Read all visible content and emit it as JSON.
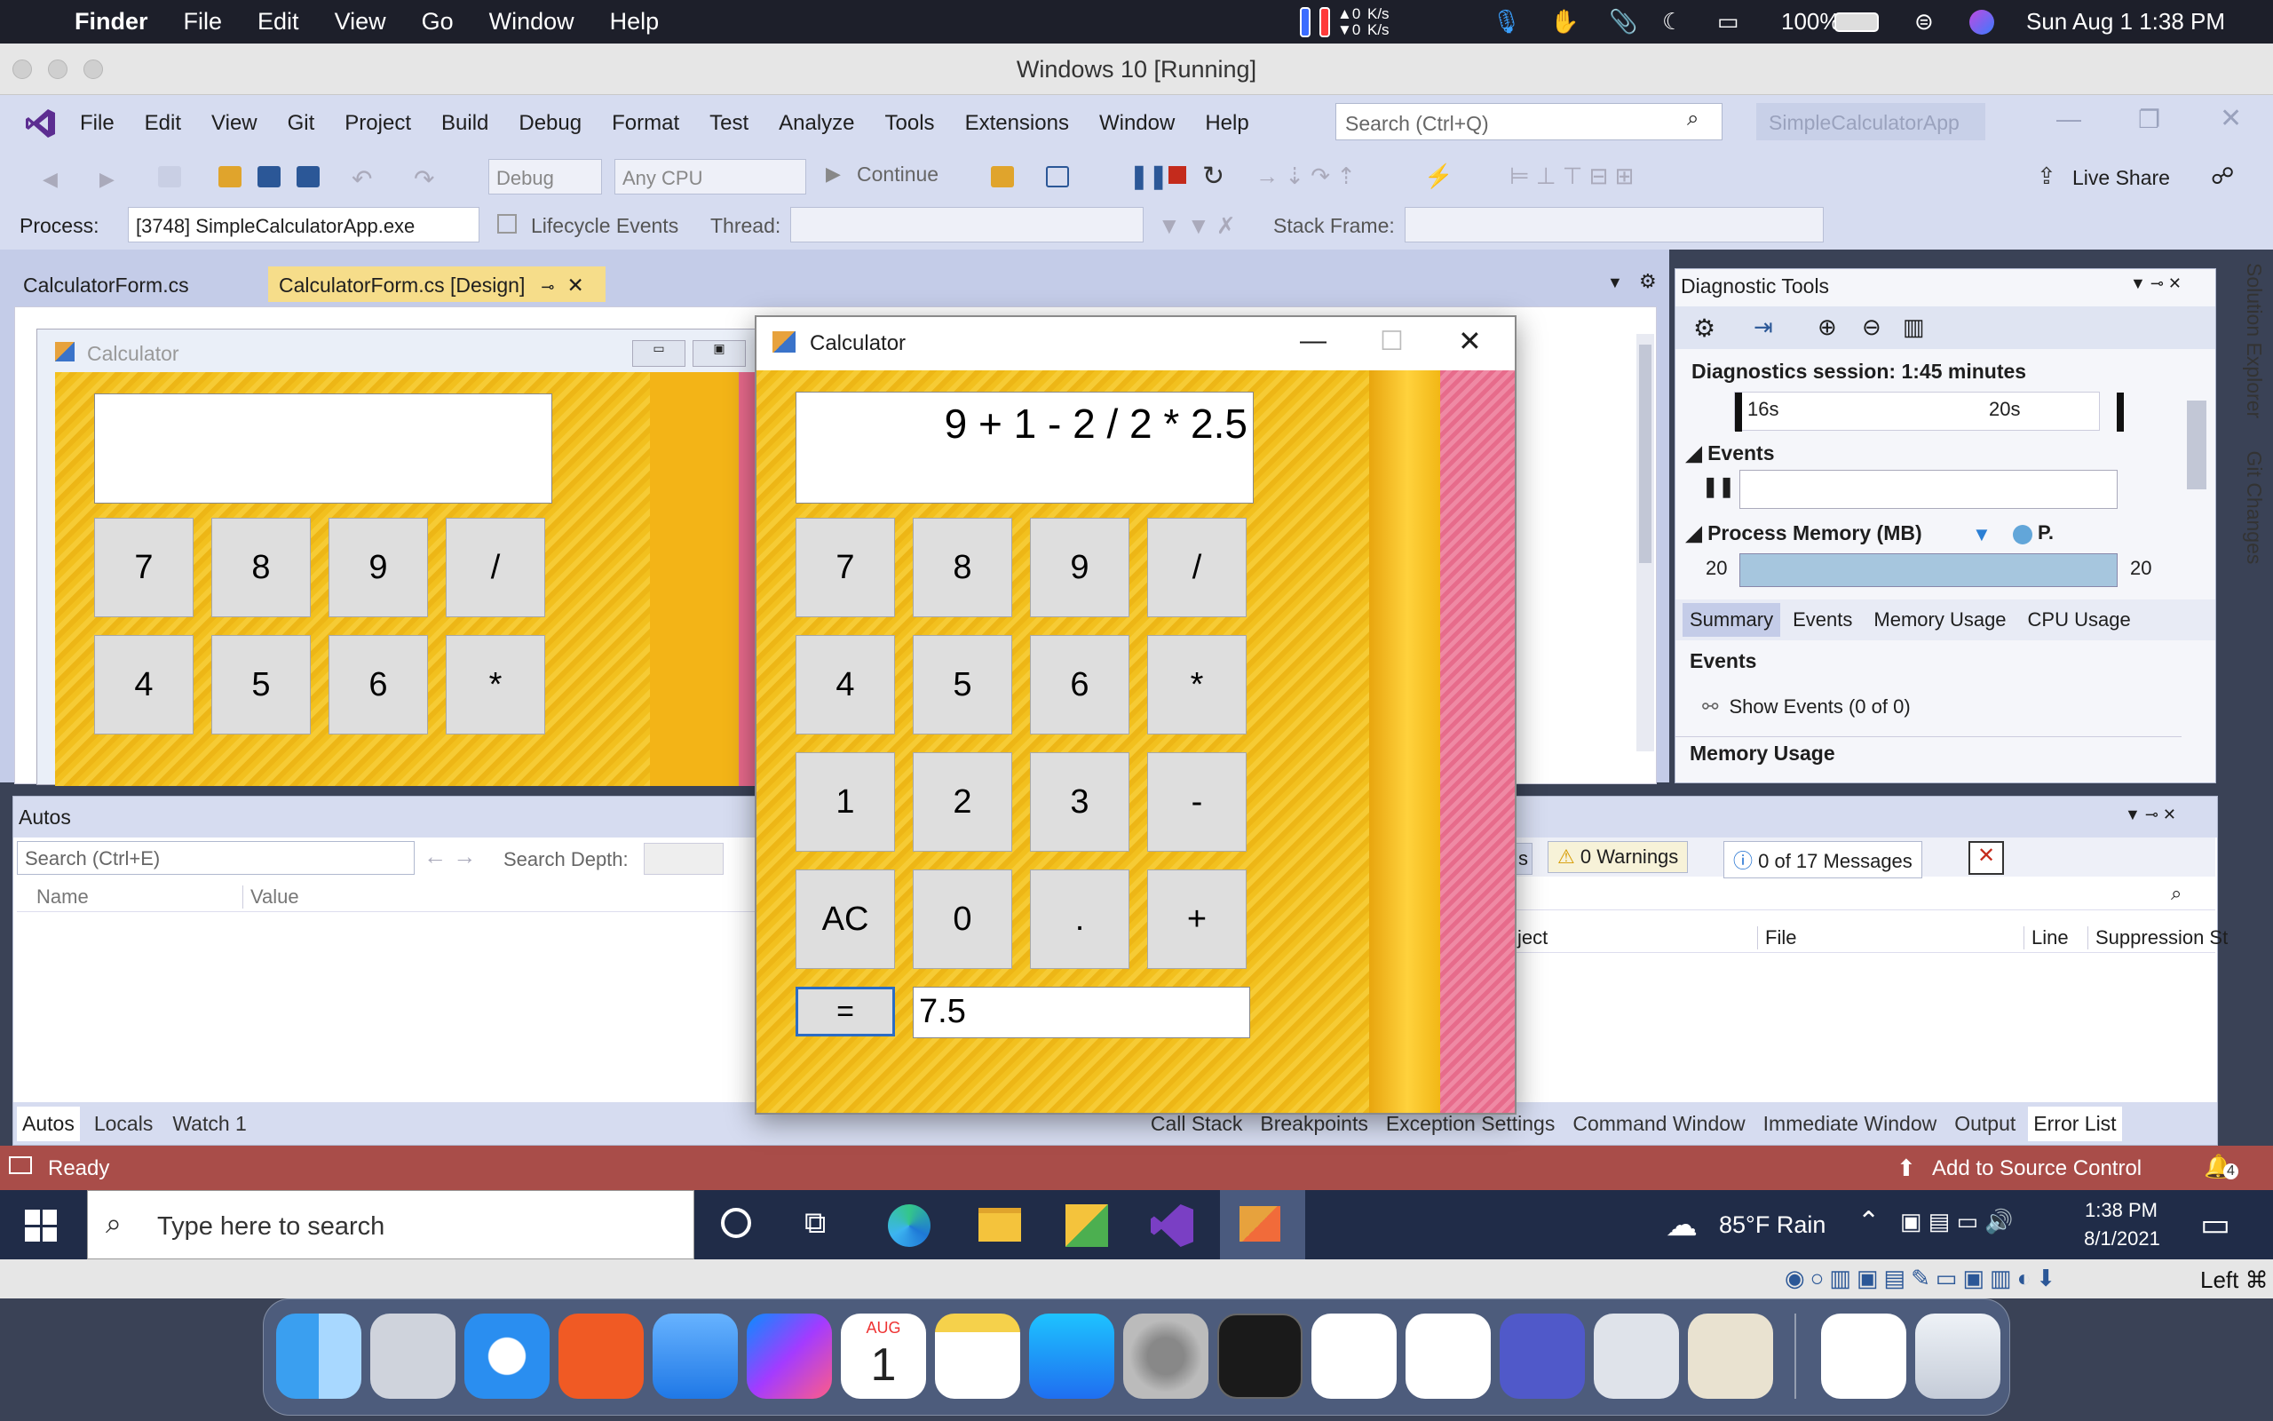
{
  "mac_menubar": {
    "app": "Finder",
    "items": [
      "File",
      "Edit",
      "View",
      "Go",
      "Window",
      "Help"
    ],
    "kbps": [
      "0\nK/s",
      "0\nK/s"
    ],
    "battery": "100%",
    "datetime": "Sun Aug 1  1:38 PM"
  },
  "vbox": {
    "title": "Windows 10 [Running]",
    "status_right": "Left ⌘"
  },
  "vs": {
    "menu": [
      "File",
      "Edit",
      "View",
      "Git",
      "Project",
      "Build",
      "Debug",
      "Format",
      "Test",
      "Analyze",
      "Tools",
      "Extensions",
      "Window",
      "Help"
    ],
    "search_placeholder": "Search (Ctrl+Q)",
    "solution": "SimpleCalculatorApp",
    "config": "Debug",
    "platform": "Any CPU",
    "continue": "Continue",
    "live_share": "Live Share",
    "process_label": "Process:",
    "process_value": "[3748] SimpleCalculatorApp.exe",
    "lifecycle": "Lifecycle Events",
    "thread_label": "Thread:",
    "stackframe_label": "Stack Frame:",
    "tabs": [
      "CalculatorForm.cs",
      "CalculatorForm.cs [Design]"
    ],
    "side_tabs": [
      "Solution Explorer",
      "Git Changes"
    ],
    "status": "Ready",
    "source_control": "Add to Source Control",
    "notif_count": "4"
  },
  "designer_form": {
    "title": "Calculator",
    "rows": [
      [
        "7",
        "8",
        "9",
        "/"
      ],
      [
        "4",
        "5",
        "6",
        "*"
      ]
    ]
  },
  "diag": {
    "title": "Diagnostic Tools",
    "session": "Diagnostics session: 1:45 minutes",
    "ticks": [
      "16s",
      "20s"
    ],
    "events_label": "Events",
    "memory_label": "Process Memory (MB)",
    "legend_p": "P.",
    "mem_left": "20",
    "mem_right": "20",
    "tabs": [
      "Summary",
      "Events",
      "Memory Usage",
      "CPU Usage"
    ],
    "section_events": "Events",
    "show_events": "Show Events (0 of 0)",
    "section_memory": "Memory Usage"
  },
  "autos": {
    "title": "Autos",
    "search_placeholder": "Search (Ctrl+E)",
    "search_depth": "Search Depth:",
    "columns": [
      "Name",
      "Value"
    ],
    "bottom_tabs": [
      "Autos",
      "Locals",
      "Watch 1"
    ],
    "right_tabs": [
      "Call Stack",
      "Breakpoints",
      "Exception Settings",
      "Command Window",
      "Immediate Window",
      "Output",
      "Error List"
    ],
    "errs_partial": "s",
    "warnings": "0 Warnings",
    "messages": "0 of 17 Messages",
    "err_columns": [
      "ject",
      "File",
      "Line",
      "Suppression St"
    ]
  },
  "calculator": {
    "title": "Calculator",
    "expression": "9 + 1 - 2 / 2 * 2.5",
    "result": "7.5",
    "buttons": [
      [
        "7",
        "8",
        "9",
        "/"
      ],
      [
        "4",
        "5",
        "6",
        "*"
      ],
      [
        "1",
        "2",
        "3",
        "-"
      ],
      [
        "AC",
        "0",
        ".",
        "+"
      ]
    ],
    "equals": "="
  },
  "taskbar": {
    "search_placeholder": "Type here to search",
    "weather": "85°F  Rain",
    "time": "1:38 PM",
    "date": "8/1/2021"
  },
  "dock": {
    "calendar_month": "AUG",
    "calendar_day": "1"
  }
}
